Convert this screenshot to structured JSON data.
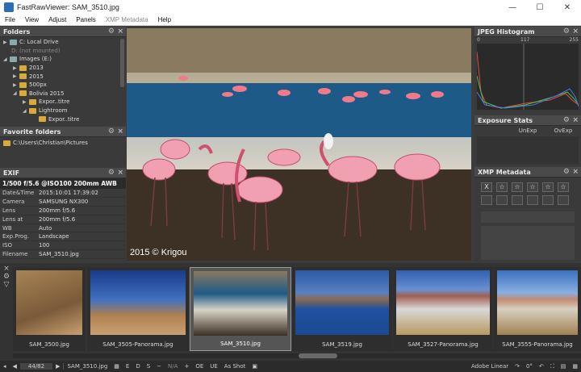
{
  "window": {
    "title": "FastRawViewer: SAM_3510.jpg",
    "minimize": "—",
    "maximize": "☐",
    "close": "✕"
  },
  "menu": {
    "file": "File",
    "view": "View",
    "adjust": "Adjust",
    "panels": "Panels",
    "xmp": "XMP Metadata",
    "help": "Help"
  },
  "folders": {
    "title": "Folders",
    "items": [
      {
        "label": "C: Local Drive",
        "arrow": "▶",
        "kind": "drive"
      },
      {
        "label": "D: (not mounted)",
        "arrow": "",
        "kind": "none"
      },
      {
        "label": "Images (E:)",
        "arrow": "◢",
        "kind": "drive"
      },
      {
        "label": "2013",
        "arrow": "▶",
        "kind": "folder"
      },
      {
        "label": "2015",
        "arrow": "▶",
        "kind": "folder"
      },
      {
        "label": "500px",
        "arrow": "▶",
        "kind": "folder"
      },
      {
        "label": "Bolivia 2015",
        "arrow": "◢",
        "kind": "folder"
      },
      {
        "label": "Expor..titre",
        "arrow": "▶",
        "kind": "folder"
      },
      {
        "label": "Lightroom",
        "arrow": "◢",
        "kind": "folder"
      },
      {
        "label": "Expor..titre",
        "arrow": "",
        "kind": "folder"
      }
    ]
  },
  "favorites": {
    "title": "Favorite folders",
    "items": [
      "C:\\Users\\Christian\\Pictures"
    ]
  },
  "exif": {
    "title": "EXIF",
    "summary": "1/500 f/5.6 @ISO100 200mm AWB",
    "rows": [
      {
        "k": "Date&Time",
        "v": "2015:10:01 17:39:02"
      },
      {
        "k": "Camera",
        "v": "SAMSUNG NX300"
      },
      {
        "k": "Lens",
        "v": "200mm f/5.6"
      },
      {
        "k": "Lens at",
        "v": "200mm f/5.6"
      },
      {
        "k": "WB",
        "v": "Auto"
      },
      {
        "k": "Exp.Prog.",
        "v": "Landscape"
      },
      {
        "k": "ISO",
        "v": "100"
      },
      {
        "k": "Filename",
        "v": "SAM_3510.jpg"
      }
    ]
  },
  "histogram": {
    "title": "JPEG Histogram",
    "ticks": [
      "0",
      "117",
      "255"
    ]
  },
  "exposure": {
    "title": "Exposure Stats",
    "unexp": "UnExp",
    "ovexp": "OvExp"
  },
  "xmp": {
    "title": "XMP Metadata",
    "stars": [
      "☆",
      "☆",
      "☆",
      "☆",
      "☆"
    ],
    "reject": "X"
  },
  "photo": {
    "watermark": "2015 © Krigou"
  },
  "thumbnails": [
    {
      "caption": "SAM_3500.jpg",
      "selected": false
    },
    {
      "caption": "SAM_3505-Panorama.jpg",
      "selected": false
    },
    {
      "caption": "SAM_3510.jpg",
      "selected": true
    },
    {
      "caption": "SAM_3519.jpg",
      "selected": false
    },
    {
      "caption": "SAM_3527-Panorama.jpg",
      "selected": false
    },
    {
      "caption": "SAM_3555-Panorama.jpg",
      "selected": false
    }
  ],
  "status": {
    "counter": "44/82",
    "filename": "SAM_3510.jpg",
    "e": "E",
    "d": "D",
    "s": "S",
    "na": "N/A",
    "oe": "OE",
    "ue": "UE",
    "wb": "As Shot",
    "profile": "Adobe Linear",
    "rotation": "0°"
  }
}
